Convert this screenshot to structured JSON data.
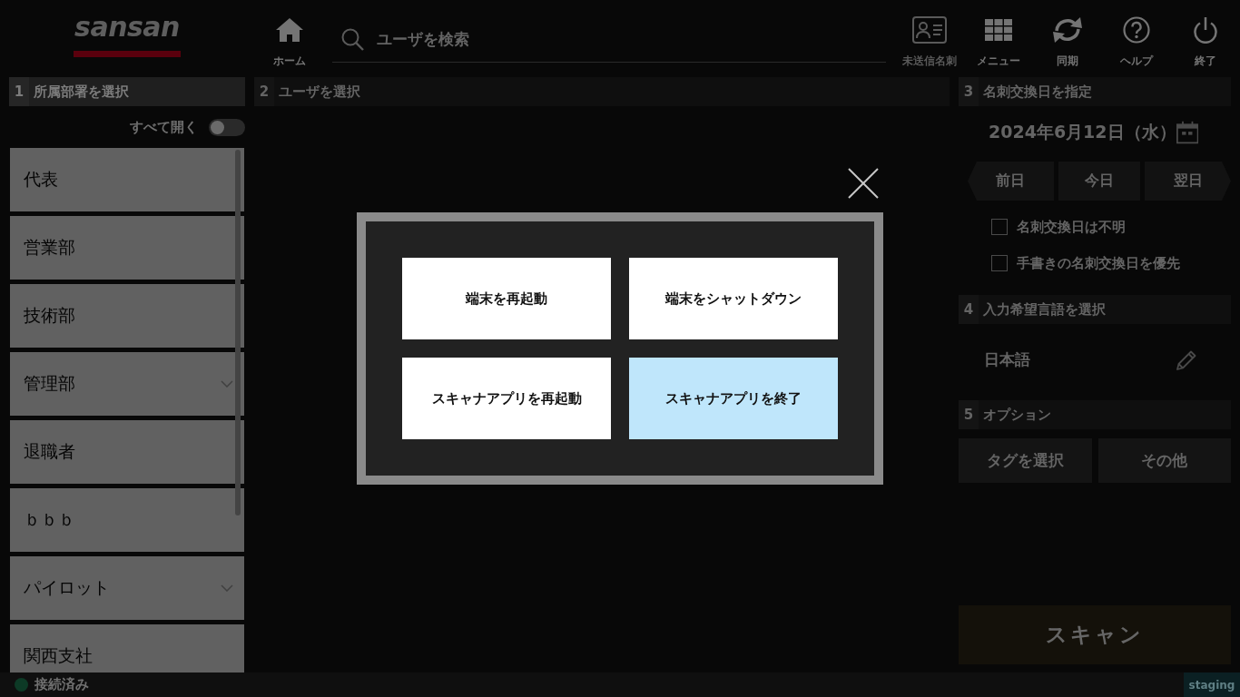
{
  "header": {
    "logo": "sansan",
    "home": {
      "label": "ホーム"
    },
    "search": {
      "placeholder": "ユーザを検索"
    },
    "tools": [
      {
        "label": "未送信名刺",
        "disabled": true
      },
      {
        "label": "メニュー",
        "disabled": false
      },
      {
        "label": "同期",
        "disabled": false
      },
      {
        "label": "ヘルプ",
        "disabled": false
      },
      {
        "label": "終了",
        "disabled": false
      }
    ]
  },
  "departments": {
    "number": "1",
    "title": "所属部署を選択",
    "disabled": false,
    "expand_all": {
      "label": "すべて開く",
      "on": false
    },
    "items": [
      {
        "name": "代表",
        "expandable": false
      },
      {
        "name": "営業部",
        "expandable": false
      },
      {
        "name": "技術部",
        "expandable": false
      },
      {
        "name": "管理部",
        "expandable": true
      },
      {
        "name": "退職者",
        "expandable": false
      },
      {
        "name": "ｂｂｂ",
        "expandable": false
      },
      {
        "name": "パイロット",
        "expandable": true
      },
      {
        "name": "関西支社",
        "expandable": false
      }
    ]
  },
  "users": {
    "number": "2",
    "title": "ユーザを選択",
    "disabled": true
  },
  "exchange_date": {
    "number": "3",
    "title": "名刺交換日を指定",
    "disabled": true,
    "date": "2024年6月12日（水）",
    "day_buttons": [
      "前日",
      "今日",
      "翌日"
    ],
    "checkboxes": [
      {
        "label": "名刺交換日は不明",
        "checked": false
      },
      {
        "label": "手書きの名刺交換日を優先",
        "checked": false
      }
    ]
  },
  "language": {
    "number": "4",
    "title": "入力希望言語を選択",
    "disabled": true,
    "value": "日本語"
  },
  "options": {
    "number": "5",
    "title": "オプション",
    "disabled": true,
    "buttons": [
      "タグを選択",
      "その他"
    ]
  },
  "scan_button": {
    "label": "スキャン",
    "disabled": true
  },
  "status_bar": {
    "connection": "接続済み",
    "environment": "staging"
  },
  "dialog": {
    "buttons": [
      {
        "label": "端末を再起動",
        "selected": false
      },
      {
        "label": "端末をシャットダウン",
        "selected": false
      },
      {
        "label": "スキャナアプリを再起動",
        "selected": false
      },
      {
        "label": "スキャナアプリを終了",
        "selected": true
      }
    ]
  }
}
